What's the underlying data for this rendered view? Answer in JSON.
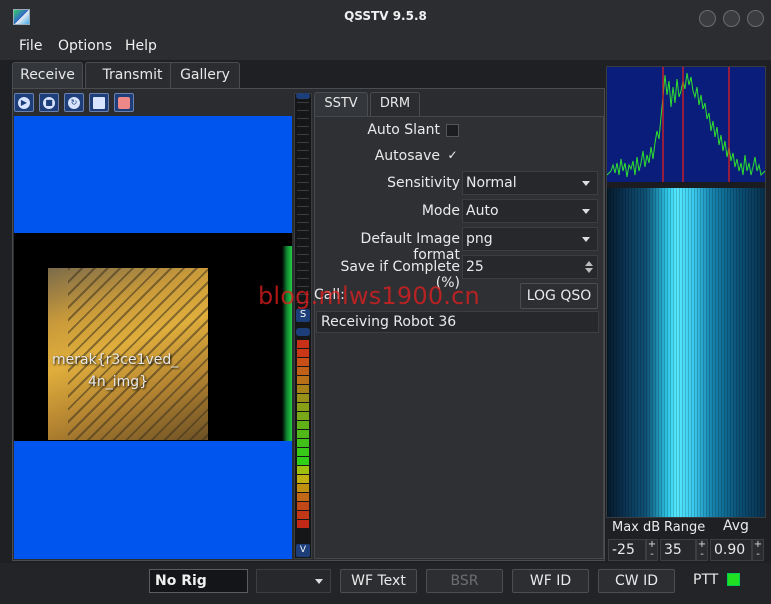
{
  "window": {
    "title": "QSSTV 9.5.8"
  },
  "menu": [
    "File",
    "Options",
    "Help"
  ],
  "main_tabs": [
    {
      "label": "Receive",
      "active": true
    },
    {
      "label": "Transmit",
      "active": false
    },
    {
      "label": "Gallery",
      "active": false
    }
  ],
  "toolbar_icons": [
    "play-icon",
    "stop-icon",
    "refresh-icon",
    "save-icon",
    "erase-icon"
  ],
  "image": {
    "text_line1": "merak{r3ce1ved_",
    "text_line2": "4n_img}"
  },
  "vu_meter": {
    "top_glyph": "S",
    "bottom_glyph": "V"
  },
  "settings_tabs": [
    {
      "label": "SSTV",
      "active": true
    },
    {
      "label": "DRM",
      "active": false
    }
  ],
  "settings": {
    "auto_slant_label": "Auto Slant",
    "auto_slant_checked": false,
    "autosave_label": "Autosave",
    "autosave_mark": "✓",
    "sensitivity_label": "Sensitivity",
    "sensitivity_value": "Normal",
    "mode_label": "Mode",
    "mode_value": "Auto",
    "image_format_label": "Default Image format",
    "image_format_value": "png",
    "save_complete_label": "Save if Complete (%)",
    "save_complete_value": "25",
    "call_label": "Call:",
    "log_qso_label": "LOG QSO",
    "status_text": "Receiving Robot 36"
  },
  "watermark": "blog.mlws1900.cn",
  "waterfall": {
    "max_db_label": "Max dB",
    "range_label": "Range",
    "avg_label": "Avg",
    "max_db_value": "-25",
    "range_value": "35",
    "avg_value": "0.90",
    "plus": "+",
    "minus": "-"
  },
  "statusbar": {
    "rig": "No Rig",
    "wf_text": "WF Text",
    "bsr": "BSR",
    "wf_id": "WF ID",
    "cw_id": "CW ID",
    "ptt": "PTT"
  },
  "colors": {
    "image_blue": "#0055ee",
    "spectrum_bg": "#0a1d7a",
    "spectrum_trace": "#2fe02f",
    "marker_red": "#e02020",
    "ptt_led": "#21e021",
    "watermark": "#e61e1e"
  }
}
